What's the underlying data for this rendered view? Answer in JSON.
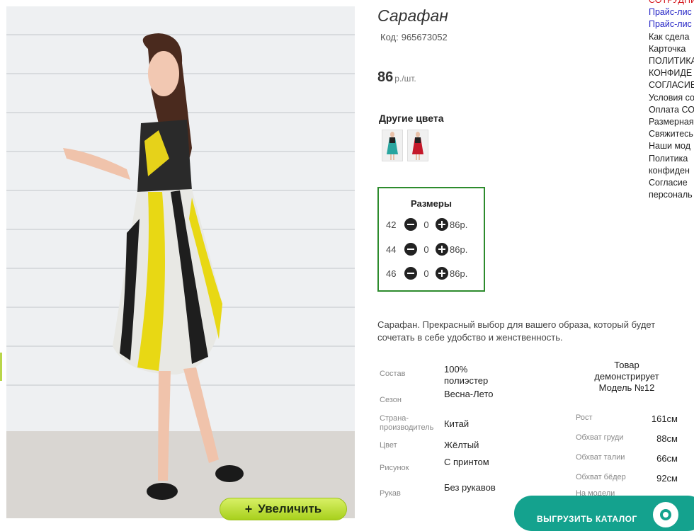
{
  "product": {
    "title": "Сарафан",
    "code_label": "Код:",
    "code": "965673052",
    "price": "86",
    "price_unit": "р./шт.",
    "description": "Сарафан. Прекрасный выбор для вашего образа, который будет сочетать в себе удобство и женственность."
  },
  "gallery": {
    "zoom_label": "Увеличить",
    "zoom_icon": "plus-icon"
  },
  "other_colors": {
    "title": "Другие цвета",
    "thumbs": [
      {
        "name": "teal-dress-thumb",
        "color": "#2aa6a0"
      },
      {
        "name": "red-dress-thumb",
        "color": "#c4182a"
      }
    ]
  },
  "sizes": {
    "title": "Размеры",
    "rows": [
      {
        "size": "42",
        "qty": "0",
        "price": "86р."
      },
      {
        "size": "44",
        "qty": "0",
        "price": "86р."
      },
      {
        "size": "46",
        "qty": "0",
        "price": "86р."
      }
    ]
  },
  "specs": [
    {
      "key": "Состав",
      "value": "100% полиэстер"
    },
    {
      "key": "Сезон",
      "value": "Весна-Лето"
    },
    {
      "key": "Страна-производитель",
      "value": "Китай"
    },
    {
      "key": "Цвет",
      "value": "Жёлтый"
    },
    {
      "key": "Рисунок",
      "value": "С принтом"
    },
    {
      "key": "Рукав",
      "value": "Без рукавов"
    }
  ],
  "model": {
    "title": "Товар демонстрирует Модель №12",
    "rows": [
      {
        "key": "Рост",
        "value": "161см"
      },
      {
        "key": "Обхват груди",
        "value": "88см"
      },
      {
        "key": "Обхват талии",
        "value": "66см"
      },
      {
        "key": "Обхват бёдер",
        "value": "92см"
      },
      {
        "key": "На модели",
        "value": ""
      }
    ]
  },
  "nav": [
    {
      "label": "СОТРУДНИ",
      "style": "red"
    },
    {
      "label": "Прайс-лис",
      "style": "blue"
    },
    {
      "label": "Прайс-лис",
      "style": "blue"
    },
    {
      "label": "Как сдела",
      "style": "plain"
    },
    {
      "label": "Карточка",
      "style": "plain"
    },
    {
      "label": "ПОЛИТИКА",
      "style": "plain"
    },
    {
      "label": "КОНФИДЕ",
      "style": "plain"
    },
    {
      "label": "СОГЛАСИЕ",
      "style": "plain"
    },
    {
      "label": "Условия со",
      "style": "plain"
    },
    {
      "label": "Оплата СО",
      "style": "plain"
    },
    {
      "label": "Размерная",
      "style": "plain"
    },
    {
      "label": "Свяжитесь",
      "style": "plain"
    },
    {
      "label": "Наши мод",
      "style": "plain"
    },
    {
      "label": "Политика",
      "style": "plain"
    },
    {
      "label": "конфиден",
      "style": "plain"
    },
    {
      "label": "Согласие",
      "style": "plain"
    },
    {
      "label": "персональ",
      "style": "plain"
    }
  ],
  "export": {
    "label": "ВЫГРУЗИТЬ КАТАЛОГ"
  },
  "colors": {
    "accent_green": "#a8d01c",
    "sizes_border": "#2d8b2d",
    "export_teal": "#14a28e",
    "nav_red": "#d4161c",
    "nav_blue": "#2424c6"
  }
}
